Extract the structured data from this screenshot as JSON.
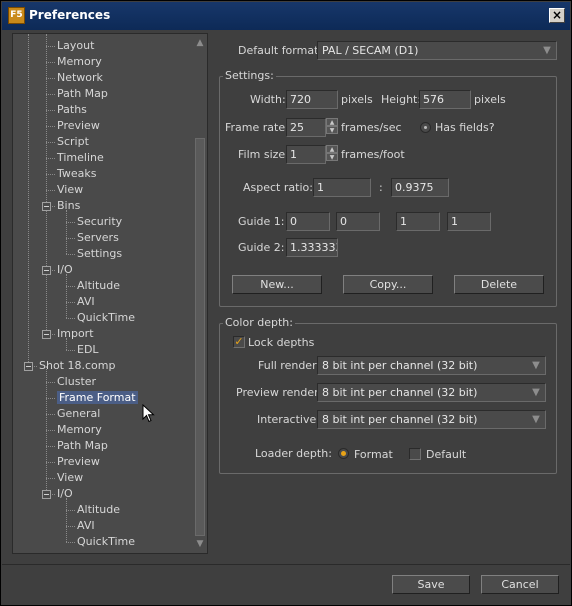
{
  "window": {
    "title": "Preferences",
    "icon": "F5",
    "close_label": "×"
  },
  "tree": {
    "items": [
      {
        "label": "Layout"
      },
      {
        "label": "Memory"
      },
      {
        "label": "Network"
      },
      {
        "label": "Path Map"
      },
      {
        "label": "Paths"
      },
      {
        "label": "Preview"
      },
      {
        "label": "Script"
      },
      {
        "label": "Timeline"
      },
      {
        "label": "Tweaks"
      },
      {
        "label": "View"
      },
      {
        "label": "Bins"
      },
      {
        "label": "Security"
      },
      {
        "label": "Servers"
      },
      {
        "label": "Settings"
      },
      {
        "label": "I/O"
      },
      {
        "label": "Altitude"
      },
      {
        "label": "AVI"
      },
      {
        "label": "QuickTime"
      },
      {
        "label": "Import"
      },
      {
        "label": "EDL"
      },
      {
        "label": "Shot 18.comp"
      },
      {
        "label": "Cluster"
      },
      {
        "label": "Frame Format"
      },
      {
        "label": "General"
      },
      {
        "label": "Memory"
      },
      {
        "label": "Path Map"
      },
      {
        "label": "Preview"
      },
      {
        "label": "View"
      },
      {
        "label": "I/O"
      },
      {
        "label": "Altitude"
      },
      {
        "label": "AVI"
      },
      {
        "label": "QuickTime"
      }
    ],
    "selected": "Frame Format",
    "scroll_up": "▲",
    "scroll_down": "▼"
  },
  "format": {
    "default_format_label": "Default format:",
    "default_format_value": "PAL / SECAM (D1)",
    "dropdown_arrow": "▼"
  },
  "settings": {
    "group_label": "Settings:",
    "width_label": "Width:",
    "width_value": "720",
    "width_unit": "pixels",
    "height_label": "Height:",
    "height_value": "576",
    "height_unit": "pixels",
    "frame_rate_label": "Frame rate:",
    "frame_rate_value": "25",
    "frame_rate_unit": "frames/sec",
    "has_fields_label": "Has fields?",
    "film_size_label": "Film size:",
    "film_size_value": "1",
    "film_size_unit": "frames/foot",
    "aspect_label": "Aspect ratio:",
    "aspect_x": "1",
    "aspect_sep": ":",
    "aspect_y": "0.9375",
    "guide1_label": "Guide 1:",
    "guide1_values": [
      "0",
      "0",
      "1",
      "1"
    ],
    "guide2_label": "Guide 2:",
    "guide2_value": "1.333333",
    "new_button": "New...",
    "copy_button": "Copy...",
    "delete_button": "Delete"
  },
  "color_depth": {
    "group_label": "Color depth:",
    "lock_depths_label": "Lock depths",
    "lock_depths_checked": true,
    "full_render_label": "Full render:",
    "full_render_value": "8 bit int per channel (32 bit)",
    "preview_render_label": "Preview render:",
    "preview_render_value": "8 bit int per channel (32 bit)",
    "interactive_label": "Interactive:",
    "interactive_value": "8 bit int per channel (32 bit)",
    "loader_depth_label": "Loader depth:",
    "loader_format_label": "Format",
    "loader_default_label": "Default",
    "loader_selected": "Format"
  },
  "footer": {
    "save_button": "Save",
    "cancel_button": "Cancel"
  },
  "colors": {
    "accent": "#e8a317",
    "selection": "#4b5e86",
    "titlebar": "#0d2a57"
  }
}
